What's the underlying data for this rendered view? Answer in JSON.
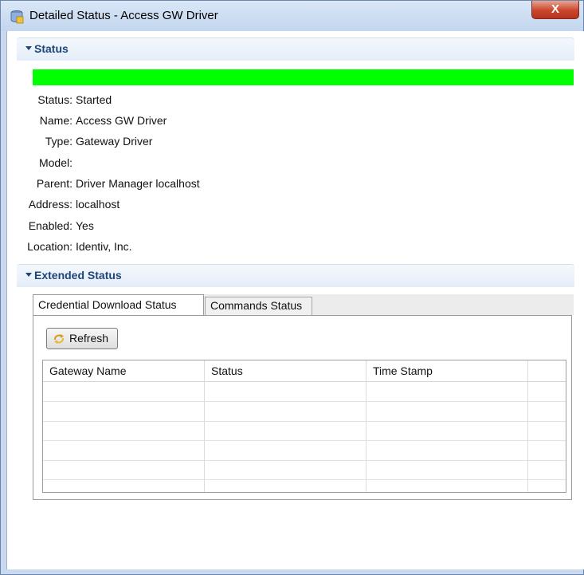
{
  "window": {
    "title": "Detailed Status - Access GW Driver",
    "close_label": "X"
  },
  "status_section": {
    "header": "Status",
    "indicator_color": "#00ff00",
    "properties": [
      {
        "label": "Status:",
        "value": "Started"
      },
      {
        "label": "Name:",
        "value": "Access GW Driver"
      },
      {
        "label": "Type:",
        "value": "Gateway Driver"
      },
      {
        "label": "Model:",
        "value": ""
      },
      {
        "label": "Parent:",
        "value": "Driver Manager localhost"
      },
      {
        "label": "Address:",
        "value": "localhost"
      },
      {
        "label": "Enabled:",
        "value": "Yes"
      },
      {
        "label": "Location:",
        "value": "Identiv, Inc."
      }
    ]
  },
  "extended_section": {
    "header": "Extended Status",
    "tabs": [
      {
        "label": "Credential Download Status",
        "active": true
      },
      {
        "label": "Commands Status",
        "active": false
      }
    ],
    "refresh_label": "Refresh",
    "table": {
      "columns": [
        "Gateway Name",
        "Status",
        "Time Stamp",
        ""
      ],
      "rows": []
    }
  },
  "icons": {
    "window_icon": "database-driver-icon",
    "refresh_icon": "refresh-arrows-icon",
    "collapse_icon": "chevron-down-icon"
  }
}
